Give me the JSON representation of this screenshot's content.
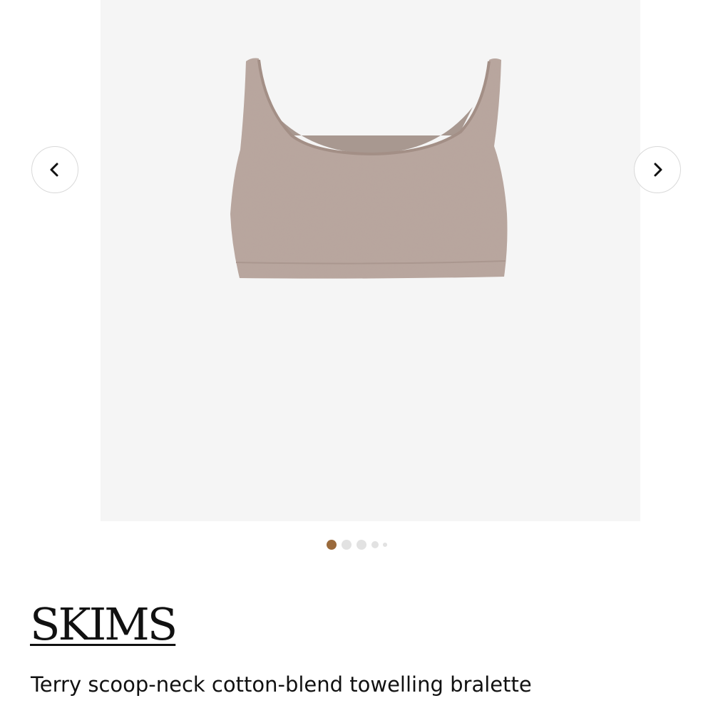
{
  "gallery": {
    "background_color": "#f5f5f5",
    "image_icon": "bralette-product-image",
    "image_color": "#b8a59d",
    "prev_icon": "chevron-left-icon",
    "next_icon": "chevron-right-icon",
    "dots": {
      "count": 5,
      "active_index": 0,
      "active_color": "#9a6a3c",
      "inactive_color": "#e2e2e2"
    }
  },
  "product": {
    "brand": "SKIMS",
    "name": "Terry scoop-neck cotton-blend towelling bralette"
  }
}
